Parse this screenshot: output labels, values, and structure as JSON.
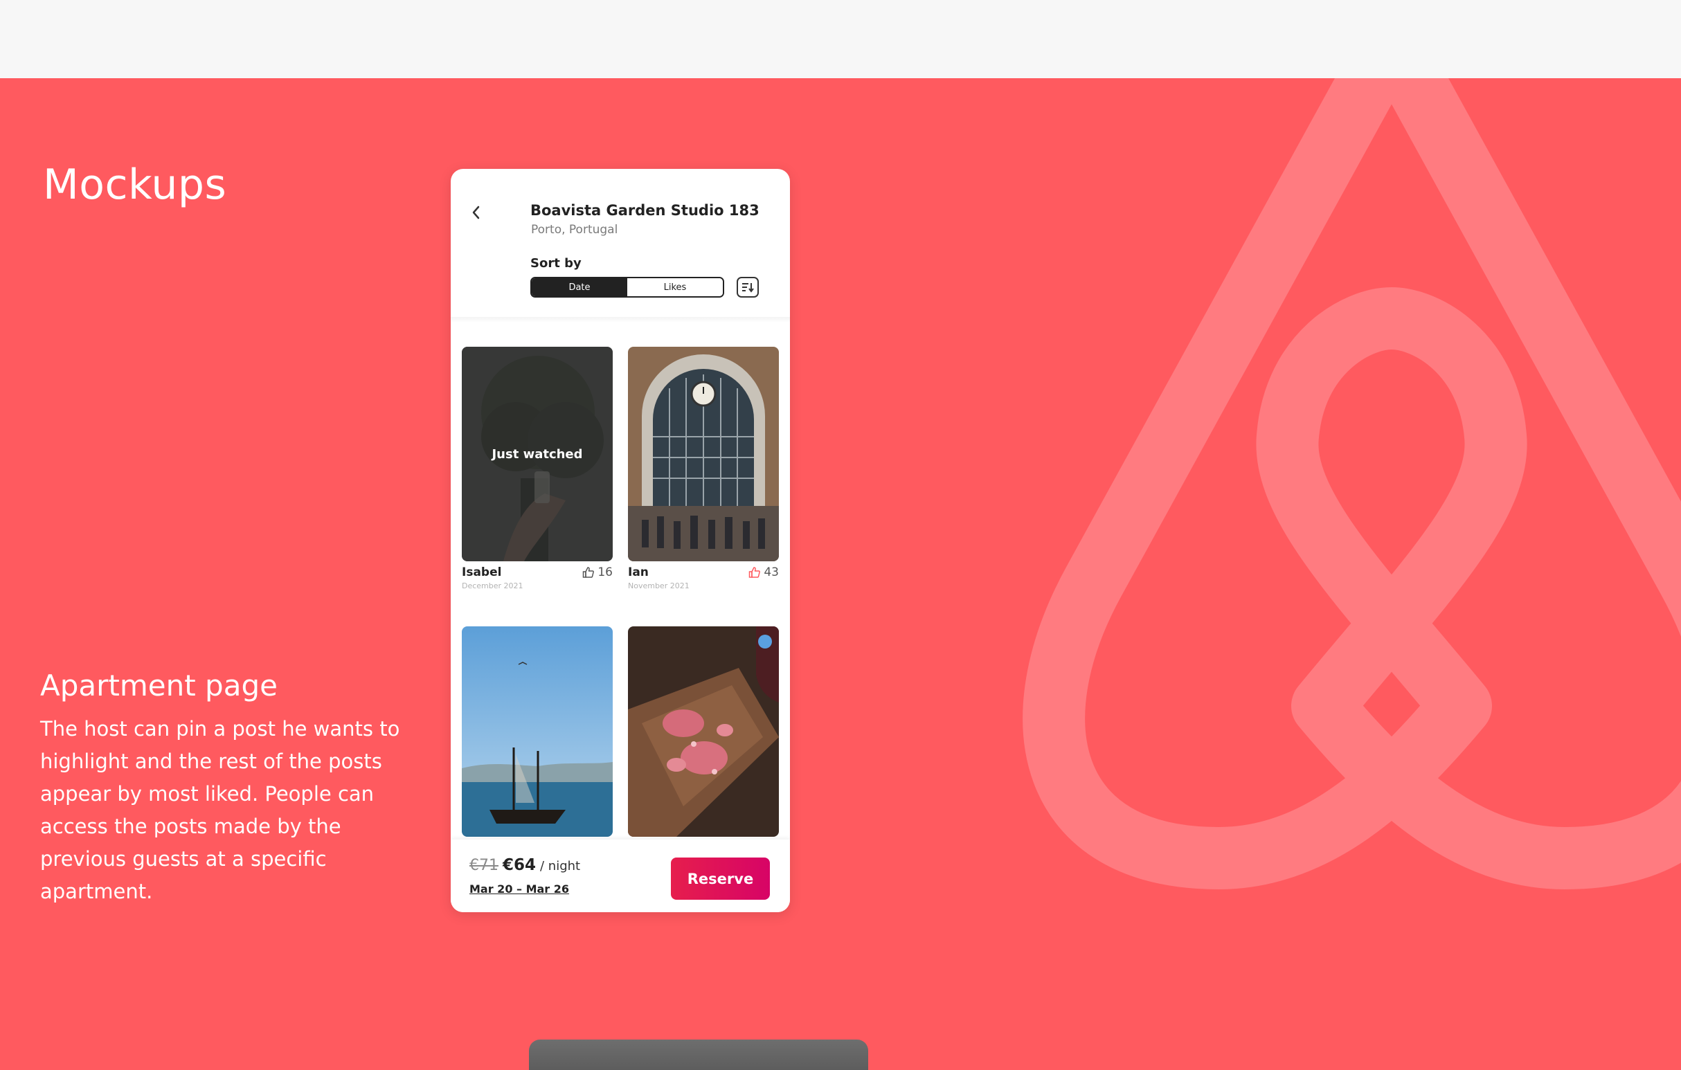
{
  "page": {
    "section_title": "Mockups",
    "description_title": "Apartment page",
    "description_body": "The host can pin a post he wants to highlight and the rest of the posts appear by most liked. People can access the posts made by the previous guests at a specific apartment."
  },
  "colors": {
    "background": "#ff5a5f",
    "top_bar": "#f7f7f7",
    "logo_watermark": "#ff7b80",
    "reserve_button": "#e61e4d",
    "like_icon_active": "#ff5a5f"
  },
  "listing": {
    "title": "Boavista Garden Studio 183",
    "location": "Porto, Portugal",
    "back_icon": "chevron-left-icon"
  },
  "sort": {
    "label": "Sort by",
    "options": [
      "Date",
      "Likes"
    ],
    "selected": "Date",
    "direction_icon": "sort-descending-icon"
  },
  "posts": [
    {
      "author": "Isabel",
      "date": "December 2021",
      "likes": "16",
      "overlay": "Just watched",
      "image": "dark-photo-drink-in-hand"
    },
    {
      "author": "Ian",
      "date": "November 2021",
      "likes": "43",
      "image": "train-station-clock-hall"
    },
    {
      "image": "boat-on-river-blue-sky"
    },
    {
      "image": "dessert-plate-on-wood-board"
    }
  ],
  "booking": {
    "old_price": "€71",
    "price": "€64",
    "per": "/ night",
    "dates": "Mar 20 – Mar 26",
    "reserve_label": "Reserve"
  }
}
